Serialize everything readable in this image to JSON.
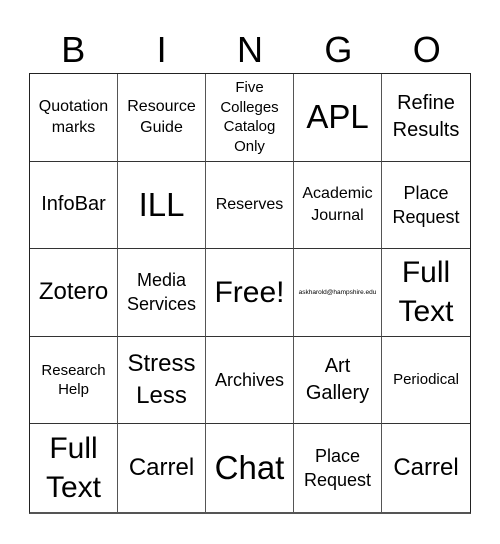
{
  "header": {
    "letters": [
      "B",
      "I",
      "N",
      "G",
      "O"
    ]
  },
  "board": {
    "cells": [
      "Quotation marks",
      "Resource Guide",
      "Five Colleges Catalog Only",
      "APL",
      "Refine Results",
      "InfoBar",
      "ILL",
      "Reserves",
      "Academic Journal",
      "Place Request",
      "Zotero",
      "Media Services",
      "Free!",
      "askharold@hampshire.edu",
      "Full Text",
      "Research Help",
      "Stress Less",
      "Archives",
      "Art Gallery",
      "Periodical",
      "Full Text",
      "Carrel",
      "Chat",
      "Place Request",
      "Carrel"
    ]
  }
}
